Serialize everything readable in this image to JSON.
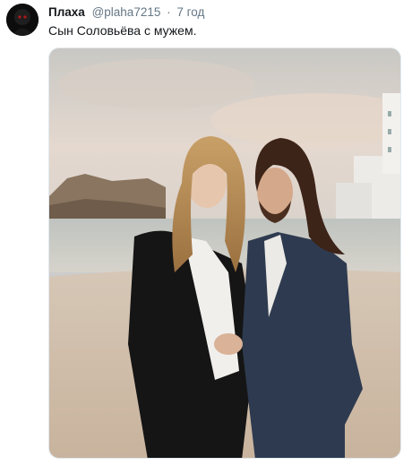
{
  "tweet": {
    "author_name": "Плаха",
    "handle": "@plaha7215",
    "separator": "·",
    "time": "7 год",
    "text": "Сын Соловьёва с мужем."
  },
  "icons": {
    "avatar": "dark-figure-avatar"
  },
  "colors": {
    "name": "#14171a",
    "meta": "#657786",
    "border": "#e1e8ed"
  }
}
